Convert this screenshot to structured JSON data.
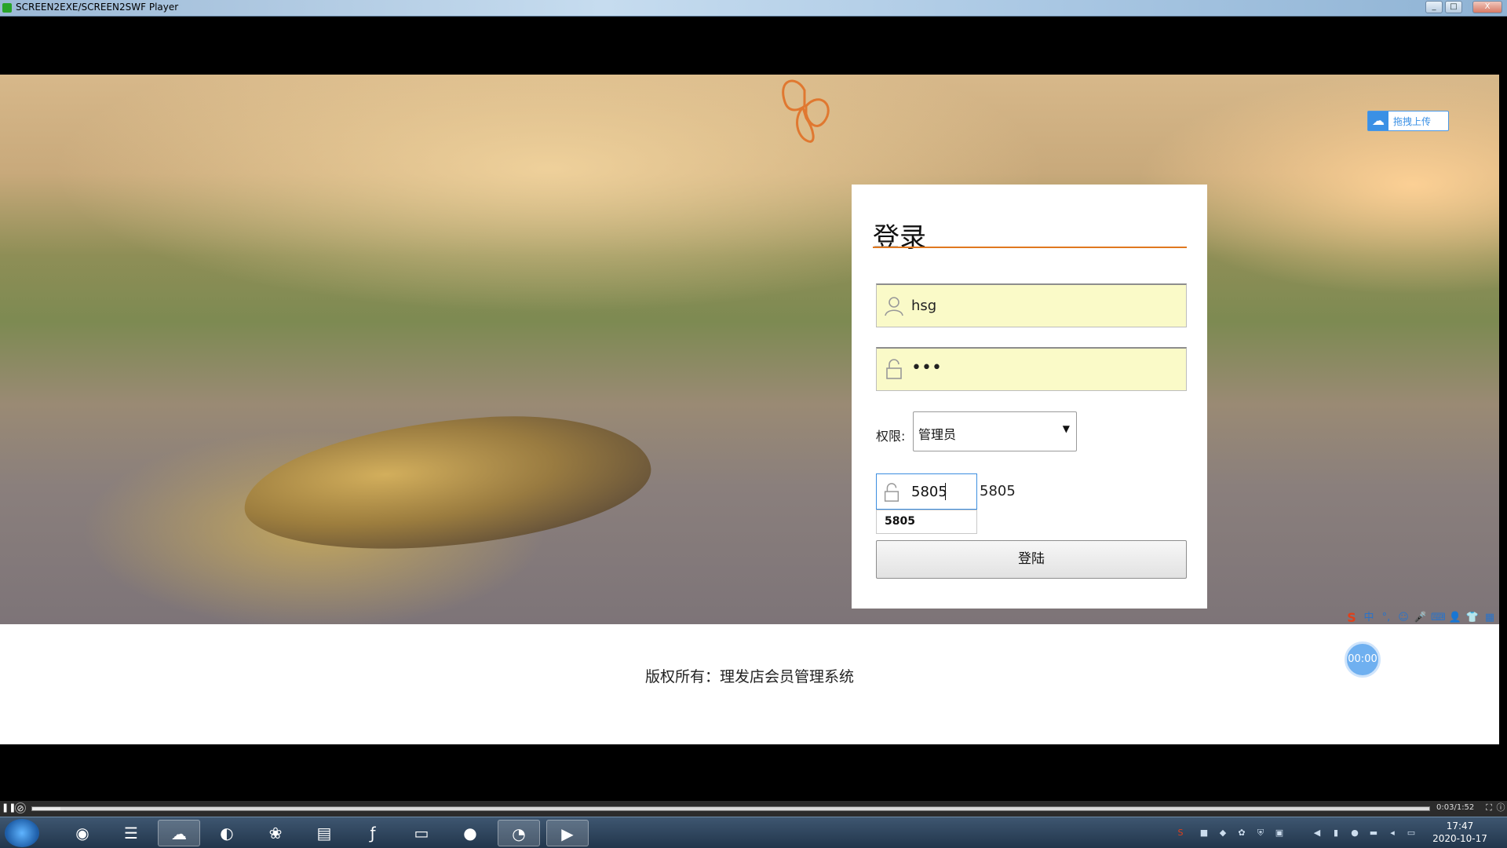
{
  "window": {
    "title": "SCREEN2EXE/SCREEN2SWF Player",
    "minimize": "_",
    "maximize": "□",
    "close": "X"
  },
  "page": {
    "drag_upload_label": "拖拽上传",
    "login": {
      "title": "登录",
      "username_value": "hsg",
      "password_value": "•••",
      "permission_label": "权限:",
      "permission_selected": "管理员",
      "captcha_value": "5805",
      "captcha_code": "5805",
      "autocomplete_suggestion": "5805",
      "submit_label": "登陆"
    },
    "footer_text": "版权所有：理发店会员管理系统",
    "timer": "00:00",
    "ime": [
      "S",
      "中",
      "°,",
      "☺",
      "🎤",
      "⌨",
      "👤",
      "👕",
      "▦"
    ]
  },
  "player": {
    "time": "0:03/1:52"
  },
  "taskbar": {
    "apps": [
      "chrome-icon",
      "eclipse-icon",
      "baidu-netdisk-icon",
      "browser-icon",
      "green-app-icon",
      "notepad-icon",
      "flash-icon",
      "explorer-icon",
      "qq-icon",
      "wechat-icon",
      "player-icon"
    ],
    "clock_time": "17:47",
    "clock_date": "2020-10-17"
  }
}
